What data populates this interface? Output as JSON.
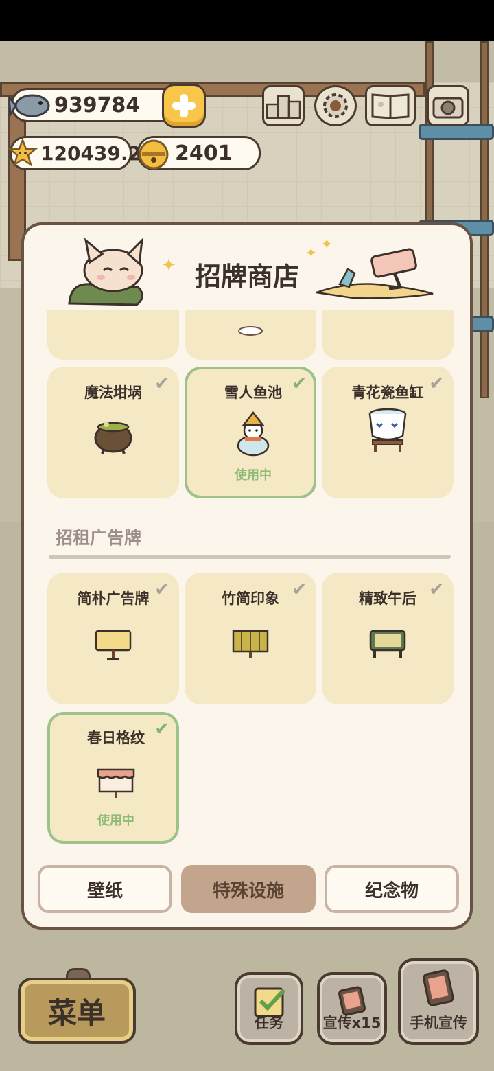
{
  "currency": {
    "fish": "939784",
    "stars": "120439.2",
    "bells": "2401"
  },
  "modal": {
    "title": "招牌商店",
    "section_title": "招租广告牌",
    "status_using": "使用中",
    "row1": [
      {
        "name": "魔法坩埚",
        "using": false
      },
      {
        "name": "雪人鱼池",
        "using": true
      },
      {
        "name": "青花瓷鱼缸",
        "using": false
      }
    ],
    "row2": [
      {
        "name": "简朴广告牌",
        "using": false
      },
      {
        "name": "竹简印象",
        "using": false
      },
      {
        "name": "精致午后",
        "using": false
      }
    ],
    "row3": [
      {
        "name": "春日格纹",
        "using": true
      }
    ],
    "tabs": [
      "壁纸",
      "特殊设施",
      "纪念物"
    ],
    "active_tab": "特殊设施"
  },
  "bottom": {
    "menu": "菜单",
    "tasks": "任务",
    "promote": "宣传x15",
    "phone_promote": "手机宣传"
  },
  "icons": {
    "plus": "plus-icon",
    "leaderboard": "ranking-icon",
    "settings": "gear-icon",
    "book": "book-icon",
    "camera": "camera-icon",
    "check": "check-icon"
  },
  "colors": {
    "using_border": "#9dc28a",
    "card_bg": "#f4e8c5",
    "active_tab": "#c3a58e"
  }
}
